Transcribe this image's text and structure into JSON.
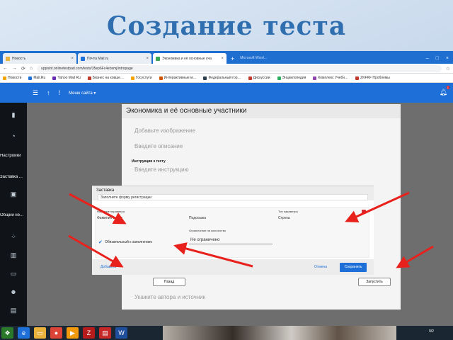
{
  "slide": {
    "title": "Создание теста"
  },
  "browser": {
    "tabs": [
      {
        "label": "Новость",
        "color": "#e8b23c",
        "active": false
      },
      {
        "label": "Почта Mail.ru",
        "color": "#1e6fd8",
        "active": false
      },
      {
        "label": "Экономика и её основные уча",
        "color": "#39a853",
        "active": true
      }
    ],
    "new_tab_label": "Microsoft Word…",
    "url": "uppoint.onlinetestpad.com/tests/35ep6Fc4ebxmj/intropage",
    "bookmarks": [
      {
        "label": "Новости",
        "color": "#f4a300"
      },
      {
        "label": "Mail.Ru",
        "color": "#1e6fd8"
      },
      {
        "label": "Yahoo Mail Ru",
        "color": "#6a2cb0"
      },
      {
        "label": "Бизнес на ковше…",
        "color": "#c0392b"
      },
      {
        "label": "Госуслуги",
        "color": "#f4a300"
      },
      {
        "label": "Интерактивные м…",
        "color": "#d35400"
      },
      {
        "label": "Федеральный гор…",
        "color": "#2c3e50"
      },
      {
        "label": "Дискуссии",
        "color": "#c0392b"
      },
      {
        "label": "Энциклопедия",
        "color": "#27ae60"
      },
      {
        "label": "Комплекс Учебн…",
        "color": "#8e44ad"
      },
      {
        "label": "ZKFKF Проблемы",
        "color": "#c0392b"
      }
    ]
  },
  "app": {
    "menu_label": "Меню сайта",
    "notification_count": "1",
    "sidebar": {
      "settings_label": "Настройки",
      "start_page_label": "Заставка ...",
      "general_label": "Общий не..."
    }
  },
  "editor": {
    "test_title": "Экономика и её основные участники",
    "add_image": "Добавьте изображение",
    "add_description": "Введите описание",
    "instruction_label": "Инструкция к тесту",
    "instruction_placeholder": "Введите инструкцию",
    "author_placeholder": "Укажите автора и источник",
    "back_button": "Назад",
    "start_button": "Запустить"
  },
  "modal": {
    "header": "Заставка",
    "form_value": "Заполните форму регистрации",
    "field_name_label": "Название параметра",
    "field_name_value": "Фамилия и имя",
    "field_hint": "Подсказка",
    "field_type_label": "Тип параметра",
    "field_type_value": "Строка",
    "limit_label": "Ограничение на количество",
    "limit_value": "Не ограничено",
    "required_label": "Обязательный к заполнению",
    "add_link": "Добавить",
    "cancel_link": "Отмена",
    "save_button": "Сохранить"
  },
  "taskbar": {
    "clock": "9/2"
  },
  "colors": {
    "accent": "#1e6fd8",
    "arrow": "#e8211c",
    "title": "#2f6fb0"
  }
}
